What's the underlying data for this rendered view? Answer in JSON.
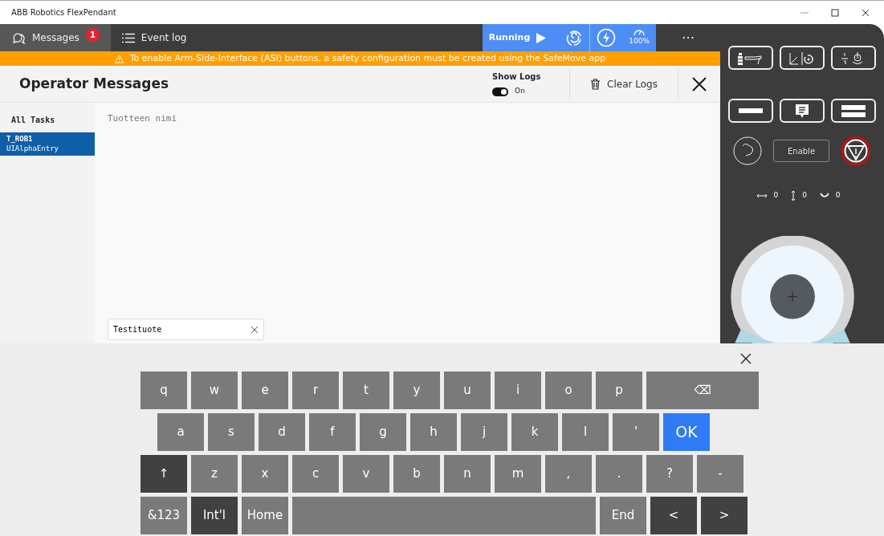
{
  "window": {
    "title": "ABB Robotics FlexPendant"
  },
  "tabs": [
    {
      "label": "Messages",
      "badge": "1",
      "selected": true
    },
    {
      "label": "Event log",
      "selected": false
    }
  ],
  "status": {
    "run_label": "Running",
    "speed": "100%",
    "more": "⋯"
  },
  "banner": {
    "text": "To enable Arm-Side-Interface (ASI) buttons, a safety configuration must be created using the SafeMove app"
  },
  "header": {
    "title": "Operator Messages",
    "show_logs": {
      "label": "Show Logs",
      "on": true,
      "state_label": "On"
    },
    "clear_label": "Clear Logs"
  },
  "sidebar": {
    "heading": "All Tasks",
    "items": [
      {
        "name": "T_ROB1",
        "sub": "UIAlphaEntry",
        "selected": true
      }
    ]
  },
  "prompt": {
    "label": "Tuotteen nimi",
    "value": "Testituote"
  },
  "jog": {
    "enable_label": "Enable",
    "readouts": [
      {
        "kind": "horizontal",
        "value": "0"
      },
      {
        "kind": "vertical",
        "value": "0"
      },
      {
        "kind": "rotate",
        "value": "0"
      }
    ]
  },
  "keyboard": {
    "rows": [
      {
        "keys": [
          {
            "label": "q",
            "kind": "char"
          },
          {
            "label": "w",
            "kind": "char"
          },
          {
            "label": "e",
            "kind": "char"
          },
          {
            "label": "r",
            "kind": "char"
          },
          {
            "label": "t",
            "kind": "char"
          },
          {
            "label": "y",
            "kind": "char"
          },
          {
            "label": "u",
            "kind": "char"
          },
          {
            "label": "i",
            "kind": "char"
          },
          {
            "label": "o",
            "kind": "char"
          },
          {
            "label": "p",
            "kind": "char"
          },
          {
            "label": "⌫",
            "kind": "backspace"
          }
        ]
      },
      {
        "keys": [
          {
            "label": "a",
            "kind": "char"
          },
          {
            "label": "s",
            "kind": "char"
          },
          {
            "label": "d",
            "kind": "char"
          },
          {
            "label": "f",
            "kind": "char"
          },
          {
            "label": "g",
            "kind": "char"
          },
          {
            "label": "h",
            "kind": "char"
          },
          {
            "label": "j",
            "kind": "char"
          },
          {
            "label": "k",
            "kind": "char"
          },
          {
            "label": "l",
            "kind": "char"
          },
          {
            "label": "'",
            "kind": "char"
          },
          {
            "label": "OK",
            "kind": "ok"
          }
        ]
      },
      {
        "keys": [
          {
            "label": "↑",
            "kind": "dark"
          },
          {
            "label": "z",
            "kind": "char"
          },
          {
            "label": "x",
            "kind": "char"
          },
          {
            "label": "c",
            "kind": "char"
          },
          {
            "label": "v",
            "kind": "char"
          },
          {
            "label": "b",
            "kind": "char"
          },
          {
            "label": "n",
            "kind": "char"
          },
          {
            "label": "m",
            "kind": "char"
          },
          {
            "label": ",",
            "kind": "char"
          },
          {
            "label": ".",
            "kind": "char"
          },
          {
            "label": "?",
            "kind": "char"
          },
          {
            "label": "-",
            "kind": "char"
          }
        ]
      },
      {
        "keys": [
          {
            "label": "&123",
            "kind": "char"
          },
          {
            "label": "Int'l",
            "kind": "dark"
          },
          {
            "label": "Home",
            "kind": "char"
          },
          {
            "kind": "space"
          },
          {
            "label": "End",
            "kind": "char"
          },
          {
            "label": "<",
            "kind": "dark"
          },
          {
            "label": ">",
            "kind": "dark"
          }
        ]
      }
    ]
  }
}
